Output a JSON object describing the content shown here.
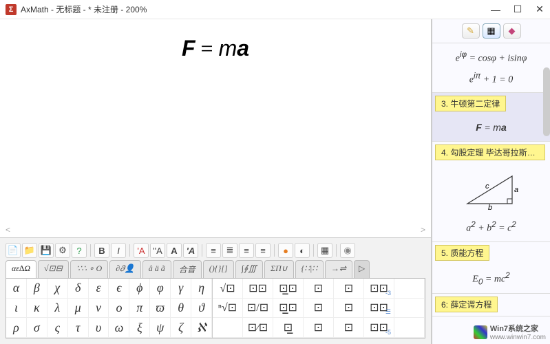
{
  "titlebar": {
    "app_icon": "Σ",
    "title": "AxMath - 无标题 - * 未注册 - 200%"
  },
  "editor": {
    "equation_html": "<span class='bold'>F</span> = <span class='it'>m</span><span class='bold'>a</span>"
  },
  "toolbar_row1": {
    "file_new": "📄",
    "file_open": "📁",
    "file_save": "💾",
    "settings": "⚙",
    "help": "?",
    "bold": "B",
    "italic": "I",
    "font_a1": "'A",
    "font_a2": "''A",
    "font_a3": "A",
    "font_a4": "'A",
    "align_l": "≡",
    "align_c": "≣",
    "align_r": "≡",
    "align_j": "≡",
    "color": "●",
    "eyedrop": "◐",
    "ruler": "▦",
    "mic": "◉"
  },
  "tabs": [
    {
      "id": "greek",
      "label": "αε∆Ω",
      "active": true
    },
    {
      "id": "roots",
      "label": "√⊡⊟"
    },
    {
      "id": "symbols",
      "label": "∵∴ ∘ O"
    },
    {
      "id": "partial",
      "label": "∂𝜕👤"
    },
    {
      "id": "accents",
      "label": "â ä ã"
    },
    {
      "id": "compose",
      "label": "合音"
    },
    {
      "id": "brackets",
      "label": "(){}[]"
    },
    {
      "id": "integrals",
      "label": "∫∮∭"
    },
    {
      "id": "sums",
      "label": "ΣΠ∪"
    },
    {
      "id": "matrix",
      "label": "{∷|∷"
    },
    {
      "id": "arrows",
      "label": "→⇌"
    },
    {
      "id": "more",
      "label": "▷"
    }
  ],
  "greek_letters": [
    "α",
    "β",
    "χ",
    "δ",
    "ε",
    "ϵ",
    "ϕ",
    "φ",
    "γ",
    "η",
    "ι",
    "κ",
    "λ",
    "μ",
    "ν",
    "o",
    "π",
    "ϖ",
    "θ",
    "ϑ",
    "ρ",
    "σ",
    "ς",
    "τ",
    "υ",
    "ω",
    "ξ",
    "ψ",
    "ζ",
    "ℵ"
  ],
  "templates": [
    {
      "label": "√⊡"
    },
    {
      "label": "⊡⊡"
    },
    {
      "label": "⊡̲⊡"
    },
    {
      "label": "⊡"
    },
    {
      "label": "⊡"
    },
    {
      "label": "⊡⊡",
      "sub": "-3"
    },
    {
      "label": ""
    },
    {
      "label": "ⁿ√⊡"
    },
    {
      "label": "⊡/⊡"
    },
    {
      "label": "⊡̲⊡"
    },
    {
      "label": "⊡"
    },
    {
      "label": "⊡"
    },
    {
      "label": "⊡⊡",
      "sub": "☰"
    },
    {
      "label": ""
    },
    {
      "label": ""
    },
    {
      "label": "⊡⁄⊡"
    },
    {
      "label": "⊡̲"
    },
    {
      "label": "⊡"
    },
    {
      "label": "⊡"
    },
    {
      "label": "⊡⊡",
      "sub": "-5"
    },
    {
      "label": ""
    }
  ],
  "right_tools": {
    "edit": "✎",
    "grid": "▦",
    "diamond": "◆"
  },
  "library": {
    "item1_eq1": "e<sup>iφ</sup> = cosφ + isinφ",
    "item1_eq2": "e<sup>iπ</sup> + 1 = 0",
    "item2_label": "3. 牛顿第二定律",
    "item2_eq": "<b><i>F</i></b> = <i>m</i><b><i>a</i></b>",
    "item3_label": "4. 勾股定理 毕达哥拉斯定...",
    "item3_sides": {
      "a": "a",
      "b": "b",
      "c": "c"
    },
    "item3_eq": "a<sup>2</sup> + b<sup>2</sup> = c<sup>2</sup>",
    "item4_label": "5. 质能方程",
    "item4_eq": "E<sub>0</sub> = mc<sup>2</sup>",
    "item5_label": "6: 薛定谔方程"
  },
  "watermark": {
    "text": "Win7系统之家",
    "url": "www.winwin7.com"
  }
}
